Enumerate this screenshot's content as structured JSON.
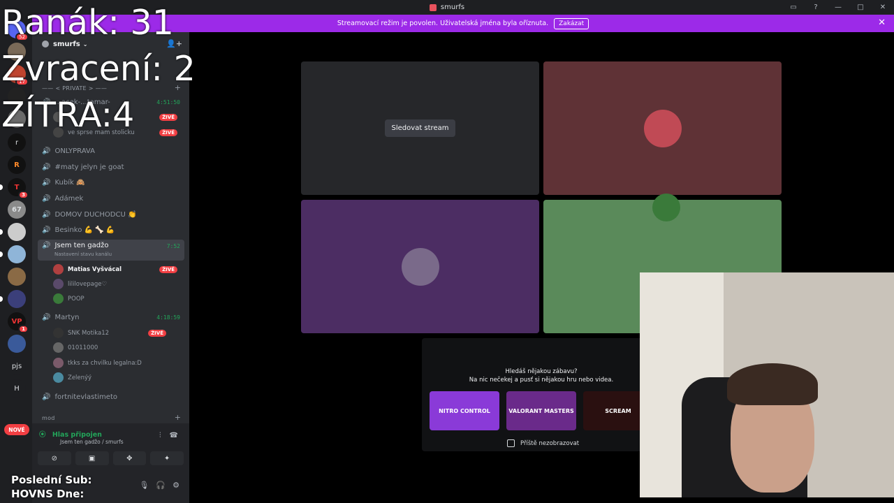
{
  "window": {
    "title": "smurfs"
  },
  "notice": {
    "text": "Streamovací režim je povolen. Uživatelská jména byla oříznuta.",
    "button": "Zakázat"
  },
  "guilds": {
    "badges": [
      "52",
      "17",
      "3",
      "1"
    ],
    "labels": [
      "r",
      "pjs",
      "H"
    ],
    "nove": "NOVÉ"
  },
  "server": {
    "name": "smurfs"
  },
  "channels": {
    "private_category": "—— < PRIVATE > ——",
    "first_channel": "...acek-...tamar-",
    "first_time": "4:51:50",
    "first_users": [
      {
        "name": "ve sprse mam stolicku",
        "live": "ŽIVĚ"
      }
    ],
    "live_label": "ŽIVĚ",
    "list": [
      "ONLYPRAVA",
      "#maty jelyn je goat",
      "Kubík 🙈",
      "Adámek",
      "DOMOV DUCHODCU 👏",
      "Besinko 💪 🦴 💪"
    ],
    "active": {
      "name": "Jsem ten gadžo",
      "time": "7:52",
      "sub": "Nastavení stavu kanálu"
    },
    "active_users": [
      {
        "name": "Matias Vyšvácal",
        "live": "ŽIVĚ"
      },
      {
        "name": "lililovepage♡",
        "live": ""
      },
      {
        "name": "POOP",
        "live": ""
      }
    ],
    "martyn": {
      "name": "Martyn",
      "time": "4:18:59"
    },
    "martyn_users": [
      {
        "name": "SNK Motika12",
        "live": "ŽIVĚ"
      },
      {
        "name": "01011000",
        "live": ""
      },
      {
        "name": "tkks za chvilku legalna:D",
        "live": ""
      },
      {
        "name": "Zelenýý",
        "live": ""
      }
    ],
    "last": "fortnitevlastimeto",
    "mod_category": "mod"
  },
  "voice": {
    "status": "Hlas připojen",
    "location": "Jsem ten gadžo / smurfs"
  },
  "stage": {
    "watch_button": "Sledovat stream"
  },
  "promo": {
    "line1": "Hledáš nějakou zábavu?",
    "line2": "Na nic nečekej a pusť si nějakou hru nebo videa.",
    "cards": [
      "NITRO CONTROL",
      "VALORANT MASTERS",
      "SCREAM"
    ],
    "checkbox": "Příště nezobrazovat"
  },
  "overlay": {
    "ranak": "Ranák: 31",
    "zvraceni": "Zvracení: 2",
    "zitra": "ZÍTRA:4",
    "last_sub": "Poslední Sub:",
    "hovns": "HOVNS Dne:"
  },
  "colors": {
    "accent_purple": "#9c2ae8",
    "live_red": "#f23f43",
    "voice_green": "#23a55a",
    "tile_red": "#5f3236",
    "tile_purple": "#4c2d63",
    "tile_green": "#5a8a5a"
  }
}
